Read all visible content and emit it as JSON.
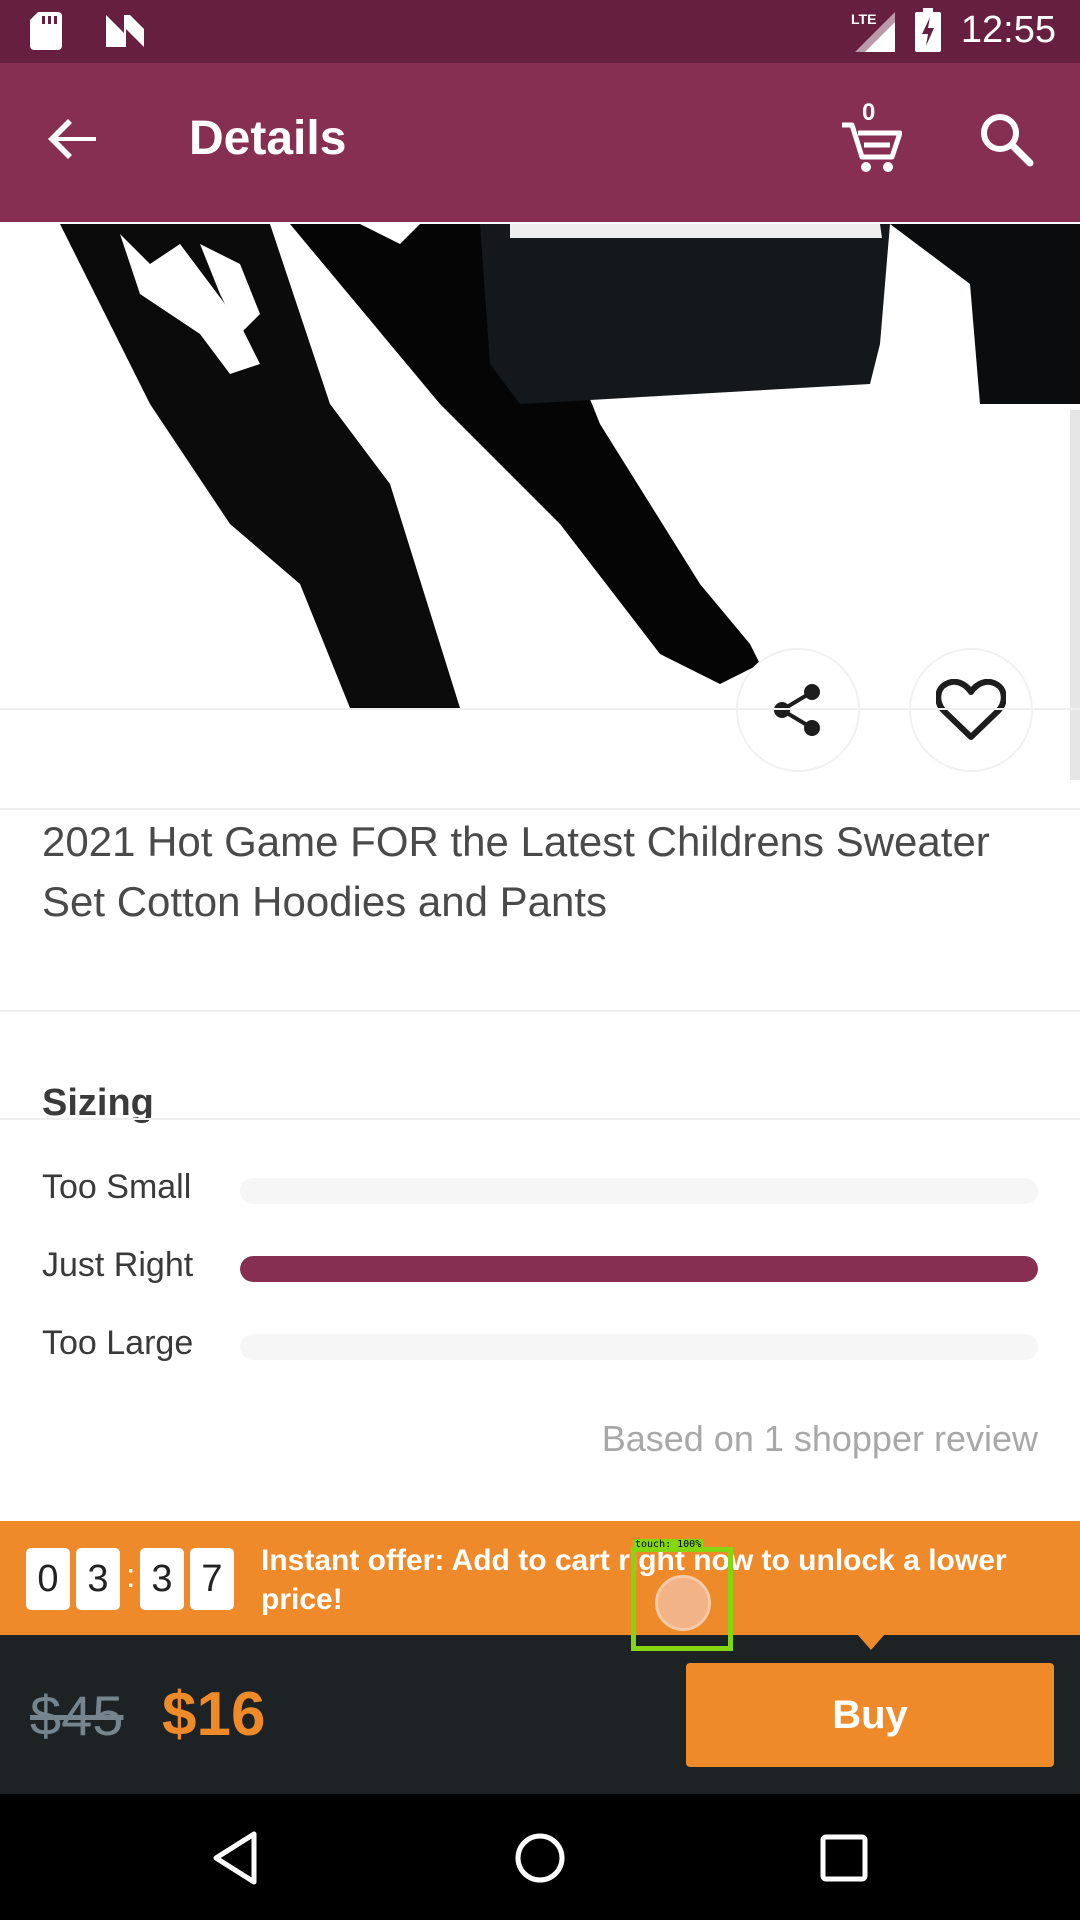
{
  "status_bar": {
    "time": "12:55",
    "network": "LTE",
    "icons": [
      "sd-card-icon",
      "n-notification-icon",
      "lte-signal-icon",
      "battery-charging-icon"
    ]
  },
  "app_bar": {
    "title": "Details",
    "cart_count": "0",
    "icons": [
      "back-arrow-icon",
      "cart-icon",
      "search-icon"
    ]
  },
  "product": {
    "title": "2021 Hot Game FOR the Latest Childrens Sweater Set Cotton Hoodies and Pants",
    "image_alt": "black hoodie and pants"
  },
  "actions": {
    "share_icon": "share-icon",
    "favorite_icon": "heart-outline-icon"
  },
  "sizing": {
    "title": "Sizing",
    "rows": [
      {
        "label": "Too Small",
        "fraction": 0
      },
      {
        "label": "Just Right",
        "fraction": 1
      },
      {
        "label": "Too Large",
        "fraction": 0
      }
    ],
    "note": "Based on 1 shopper review"
  },
  "offer": {
    "timer_digits": [
      "0",
      "3",
      "3",
      "7"
    ],
    "separator": ":",
    "text": "Instant offer: Add to cart right now to unlock a lower price!"
  },
  "purchase": {
    "old_price": "$45",
    "new_price": "$16",
    "buy_label": "Buy"
  },
  "touch_overlay": {
    "label": "touch: 100%"
  },
  "colors": {
    "status_bar": "#671f3f",
    "app_bar": "#862f51",
    "accent": "#ef8a2a",
    "buy_bar": "#1d2225"
  }
}
